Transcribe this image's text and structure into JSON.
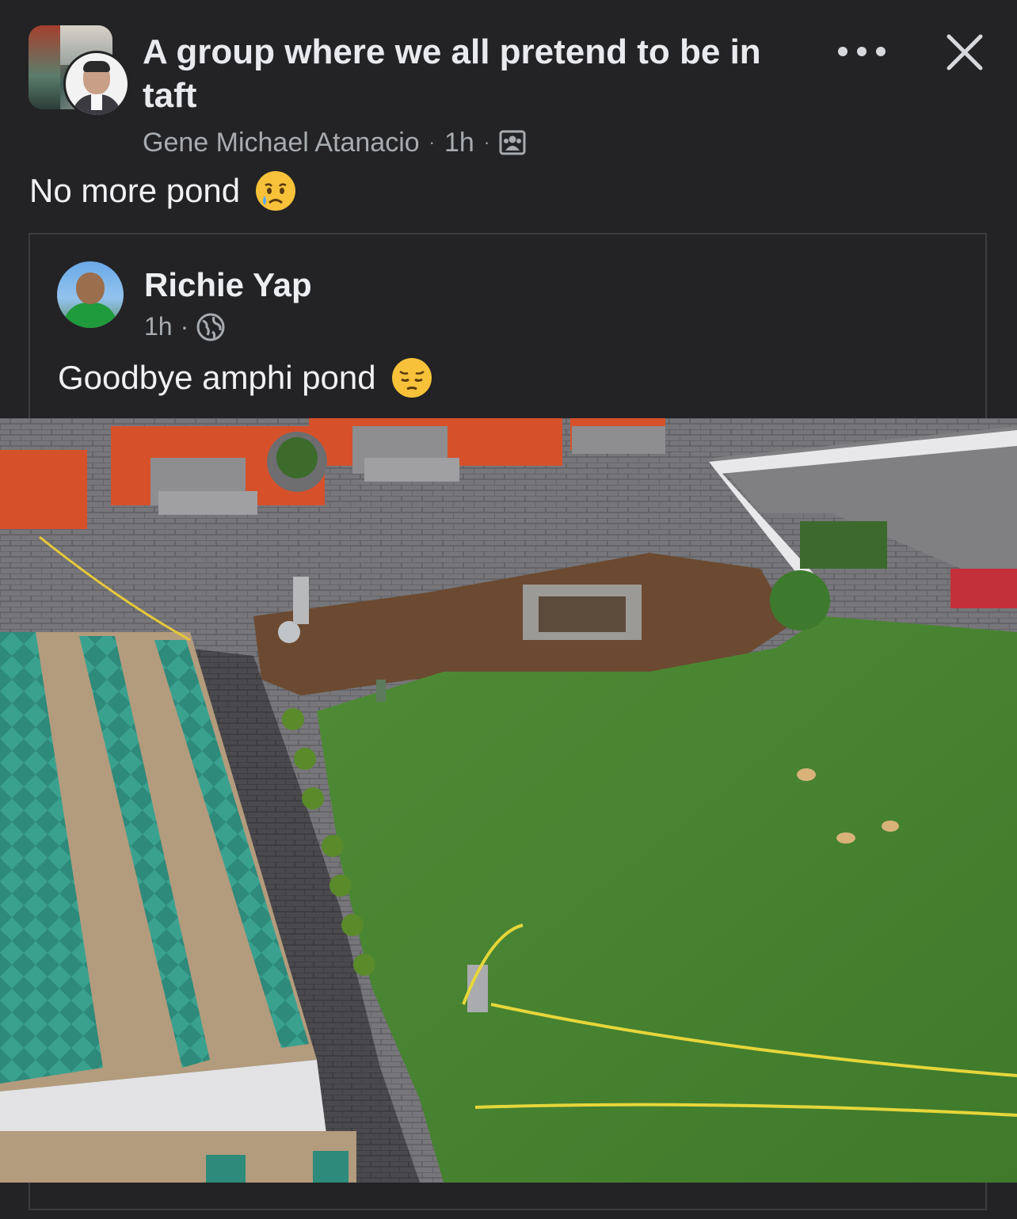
{
  "header": {
    "group_name": "A group where we all pretend to be in taft",
    "poster_name": "Gene Michael Atanacio",
    "time": "1h",
    "separator": "·",
    "audience_icon": "group-audience-icon",
    "more_icon": "more-options-icon",
    "close_icon": "close-icon"
  },
  "post": {
    "text": "No more pond",
    "emoji": "crying-face-emoji"
  },
  "shared_post": {
    "author": "Richie Yap",
    "time": "1h",
    "separator": "·",
    "audience_icon": "globe-icon",
    "text": "Goodbye amphi pond",
    "emoji": "pensive-face-emoji"
  },
  "colors": {
    "background": "#232325",
    "text_primary": "#e9eaee",
    "text_secondary": "#a8abaf",
    "card_border": "#3b3c3f"
  }
}
